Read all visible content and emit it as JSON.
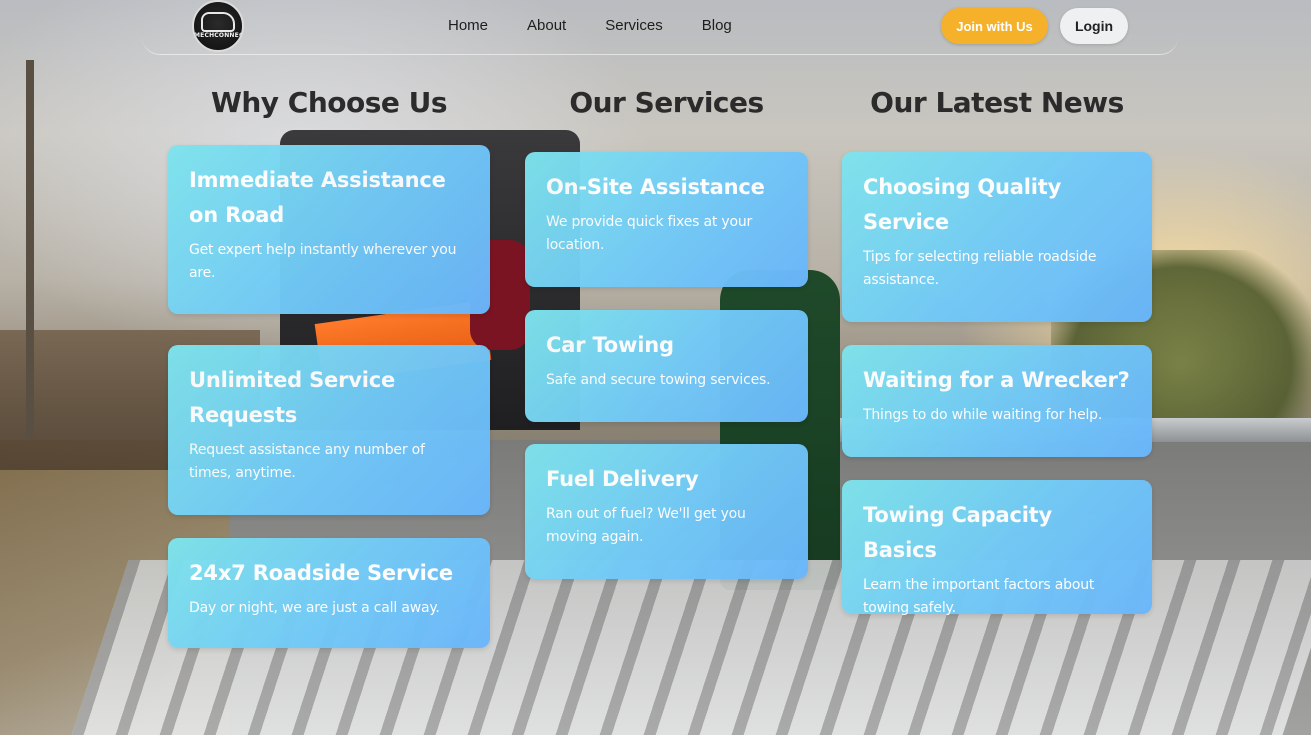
{
  "header": {
    "logo_text": "MECHCONNECT",
    "nav": [
      "Home",
      "About",
      "Services",
      "Blog"
    ],
    "join_label": "Join with Us",
    "login_label": "Login"
  },
  "sections": {
    "why": {
      "title": "Why Choose Us",
      "cards": [
        {
          "title": "Immediate Assistance on Road",
          "desc": "Get expert help instantly wherever you are."
        },
        {
          "title": "Unlimited Service Requests",
          "desc": "Request assistance any number of times, anytime."
        },
        {
          "title": "24x7 Roadside Service",
          "desc": "Day or night, we are just a call away."
        }
      ]
    },
    "services": {
      "title": "Our Services",
      "cards": [
        {
          "title": "On-Site Assistance",
          "desc": "We provide quick fixes at your location."
        },
        {
          "title": "Car Towing",
          "desc": "Safe and secure towing services."
        },
        {
          "title": "Fuel Delivery",
          "desc": "Ran out of fuel? We'll get you moving again."
        }
      ]
    },
    "news": {
      "title": "Our Latest News",
      "cards": [
        {
          "title": "Choosing Quality Service",
          "desc": "Tips for selecting reliable roadside assistance."
        },
        {
          "title": "Waiting for a Wrecker?",
          "desc": "Things to do while waiting for help."
        },
        {
          "title": "Towing Capacity Basics",
          "desc": "Learn the important factors about towing safely."
        }
      ]
    }
  },
  "colors": {
    "accent": "#f6b12a",
    "card_start": "#7ee4ec",
    "card_end": "#6ab6fb",
    "heading": "#2b2b2b"
  }
}
